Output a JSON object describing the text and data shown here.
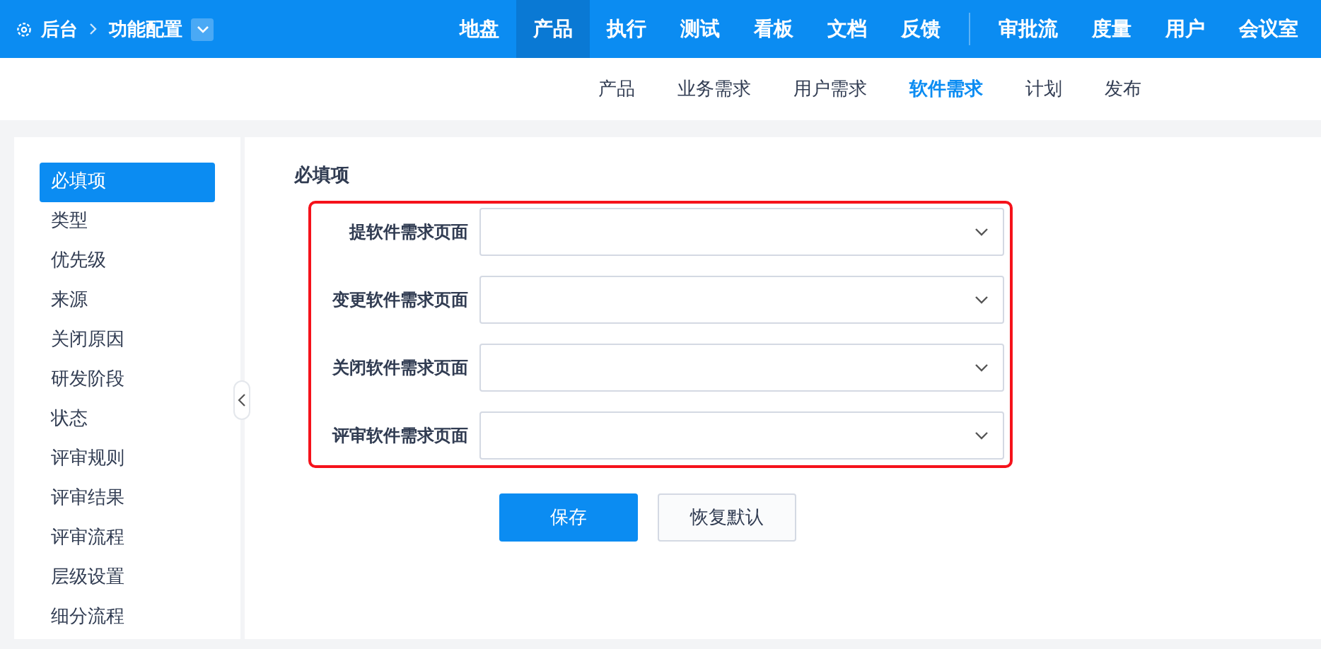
{
  "breadcrumb": {
    "home": "后台",
    "current": "功能配置"
  },
  "main_nav": [
    {
      "label": "地盘",
      "selected": false
    },
    {
      "label": "产品",
      "selected": true
    },
    {
      "label": "执行",
      "selected": false
    },
    {
      "label": "测试",
      "selected": false
    },
    {
      "label": "看板",
      "selected": false
    },
    {
      "label": "文档",
      "selected": false
    },
    {
      "label": "反馈",
      "selected": false
    },
    {
      "label": "审批流",
      "selected": false,
      "group_start": true
    },
    {
      "label": "度量",
      "selected": false
    },
    {
      "label": "用户",
      "selected": false
    },
    {
      "label": "会议室",
      "selected": false
    }
  ],
  "sub_nav": [
    {
      "label": "产品",
      "selected": false
    },
    {
      "label": "业务需求",
      "selected": false
    },
    {
      "label": "用户需求",
      "selected": false
    },
    {
      "label": "软件需求",
      "selected": true
    },
    {
      "label": "计划",
      "selected": false
    },
    {
      "label": "发布",
      "selected": false
    }
  ],
  "sidebar": {
    "items": [
      {
        "label": "必填项",
        "selected": true
      },
      {
        "label": "类型",
        "selected": false
      },
      {
        "label": "优先级",
        "selected": false
      },
      {
        "label": "来源",
        "selected": false
      },
      {
        "label": "关闭原因",
        "selected": false
      },
      {
        "label": "研发阶段",
        "selected": false
      },
      {
        "label": "状态",
        "selected": false
      },
      {
        "label": "评审规则",
        "selected": false
      },
      {
        "label": "评审结果",
        "selected": false
      },
      {
        "label": "评审流程",
        "selected": false
      },
      {
        "label": "层级设置",
        "selected": false
      },
      {
        "label": "细分流程",
        "selected": false
      }
    ]
  },
  "form": {
    "title": "必填项",
    "highlighted": true,
    "fields": [
      {
        "label": "提软件需求页面"
      },
      {
        "label": "变更软件需求页面"
      },
      {
        "label": "关闭软件需求页面"
      },
      {
        "label": "评审软件需求页面"
      }
    ],
    "buttons": [
      {
        "label": "保存",
        "kind": "primary"
      },
      {
        "label": "恢复默认",
        "kind": "secondary"
      }
    ]
  }
}
